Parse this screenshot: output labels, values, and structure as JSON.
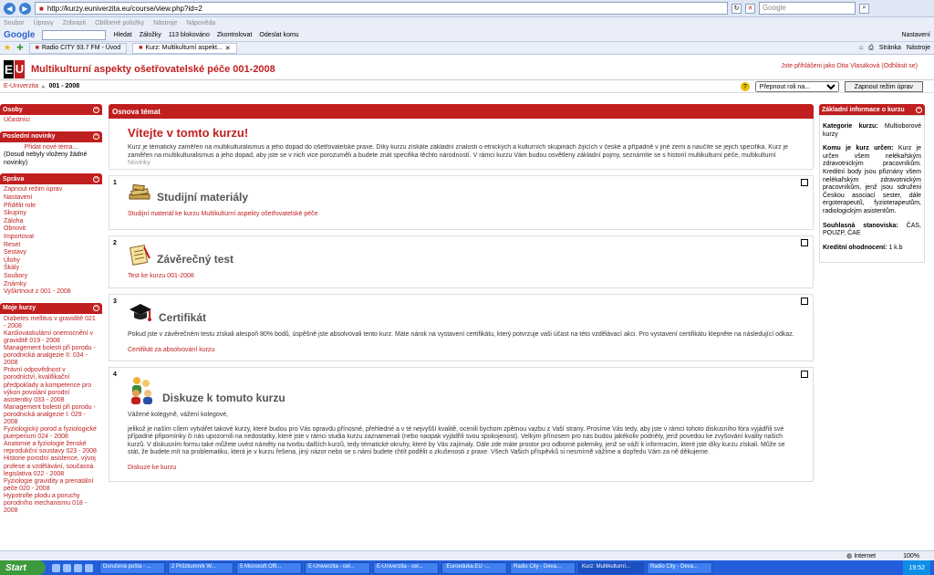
{
  "browser": {
    "url": "http://kurzy.euniverzita.eu/course/view.php?id=2",
    "search_placeholder": "Google",
    "menu": [
      "Soubor",
      "Úpravy",
      "Zobrazit",
      "Oblíbené položky",
      "Nástroje",
      "Nápověda"
    ],
    "google_toolbar": {
      "logo": "Google",
      "search": "Hledat",
      "bookmarks": "Záložky",
      "blocked": "113 blokováno",
      "check": "Zkontrolovat",
      "send": "Odeslat komu",
      "settings": "Nastavení"
    },
    "tabs": [
      {
        "label": "Radio CITY 93.7 FM - Úvod"
      },
      {
        "label": "Kurz: Multikulturní aspekt..."
      }
    ],
    "tools": {
      "page": "Stránka",
      "tools": "Nástroje"
    }
  },
  "site": {
    "logo_e": "E",
    "logo_u": "U",
    "course_title": "Multikulturní aspekty ošetřovatelské péče 001-2008",
    "login_info": "Jste přihlášeni jako Dita Vlasáková (Odhlásit se)",
    "breadcrumb_home": "E-Univerzita",
    "breadcrumb_sep": "▸",
    "breadcrumb_current": "001 - 2008",
    "role_select": "Přepnout roli na...",
    "edit_button": "Zapnout režim úprav",
    "help": "?"
  },
  "left": {
    "osoby": {
      "title": "Osoby",
      "items": [
        "Účastníci"
      ]
    },
    "news": {
      "title": "Poslední novinky",
      "add": "Přidat nové téma...",
      "none": "(Dosud nebyly vloženy žádné novinky)"
    },
    "admin": {
      "title": "Správa",
      "items": [
        "Zapnout režim úprav",
        "Nastavení",
        "Přidělit role",
        "Skupiny",
        "Záloha",
        "Obnovit",
        "Importovat",
        "Reset",
        "Sestavy",
        "Úlohy",
        "Škály",
        "Soubory",
        "Známky",
        "Vyškrtnout z 001 - 2008"
      ]
    },
    "mycourses": {
      "title": "Moje kurzy",
      "items": [
        "Diabetes mellitus v graviditě 021 - 2008",
        "Kardiovaskulární onemocnění v graviditě 019 - 2008",
        "Management bolesti při porodu - porodnická analgezie II: 034 - 2008",
        "Právní odpovědnost v porodnictví, kvalifikační předpoklady a kompetence pro výkon povolání porodní asistentky 033 - 2008",
        "Management bolesti při porodu - porodnická analgezie I: 029 - 2008",
        "Fyziologický porod a fyziologické puerperium 024 - 2008",
        "Anatomie a fyziologie ženské reprodukční soustavy 023 - 2008",
        "Historie porodní asistence, vývoj profese a vzdělávání, současná legislativa 022 - 2008",
        "Fyziologie gravidity a prenatální péče 020 - 2008",
        "Hypotrofie plodu a poruchy porodního mechanismu 018 - 2008"
      ]
    }
  },
  "center": {
    "header": "Osnova témat",
    "welcome_title": "Vítejte v tomto kurzu!",
    "welcome_text": "Kurz je tématicky zaměřen na multikulturalismus a jeho dopad do ošetřovatelské praxe. Díky kurzu získáte základní znalosti o etnických a kulturních skupinách žijících v české a případně v jiné zemi a naučíte se jejich specifika. Kurz je zaměřen na multikulturalismus a jeho dopad, aby jste se v nich vice porozuměli a budete znát specifika těchto národností. V rámci kurzu Vám budou osvětleny základní pojmy, seznámíte se s historií multikulturní péče, multikulturní výchovou i s etickými zásadami.",
    "welcome_news": "Novinky",
    "sections": [
      {
        "num": "1",
        "title": "Studijní materiály",
        "text": "",
        "link": "Studijní materiál ke kurzu Multikulturní aspekty ošetřovatelské péče",
        "icon": "books-icon"
      },
      {
        "num": "2",
        "title": "Závěrečný test",
        "text": "",
        "link": "Test ke kurzu 001-2008",
        "icon": "notepad-icon"
      },
      {
        "num": "3",
        "title": "Certifikát",
        "text": "Pokud jste v závěrečném testu získali alespoň 80% bodů, úspěšně jste absolvovali tento kurz. Máte nárok na vystavení certifikátu, který potvrzuje vaši účast na této vzdělávací akci. Pro vystavení certifikátu klepněte na následující odkaz.",
        "link": "Certifikát za absolvování kurzu",
        "icon": "graduation-cap-icon"
      },
      {
        "num": "4",
        "title": "Diskuze k tomuto kurzu",
        "greeting": "Vážené kolegyně, vážení kolegové,",
        "text": "jelikož je naším cílem vytvářet takové kurzy, které budou pro Vás opravdu přínosné, přehledné a v té nejvyšší kvalitě, ocenili bychom zpětnou vazbu z Vaší strany. Prosíme Vás tedy, aby jste v rámci tohoto diskusního fóra vyjádřili své případné připomínky či nás upozornili na nedostatky, které jste v rámci studia kurzu zaznamenali (nebo naopak vyjádřili svou spokojenost). Velkým přínosem pro nás budou jakékoliv podněty, jenž povedou ke zvyšování kvality našich kurzů. V diskusním formu také můžete uvést náměty na tvorbu dalších kurzů, tedy tématické okruhy, které by Vás zajímaly. Dále zde máte prostor pro odborné polemiky, jenž se váží k informacím, které jste díky kurzu získali. Může se stát, že budete mít na problematiku, která je v kurzu řešena, jiný názor nebo se s námi budete chtít podělit o zkušenosti z praxe. Všech Vašich příspěvků si nesmírně vážíme a dopředu Vám za ně děkujeme.",
        "link": "Diskuze ke kurzu",
        "icon": "people-icon"
      }
    ]
  },
  "right": {
    "title": "Základní informace o kurzu",
    "category_label": "Kategorie kurzu:",
    "category_value": "Multioborové kurzy",
    "for_label": "Komu je kurz určen:",
    "for_value": "Kurz je určen všem nelékařským zdravotnickým pracovníkům. Kreditní body jsou přiznány všem nelékařským zdravotnickým pracovníkům, jenž jsou sdruženi Českou asociací sester, dále ergoterapeutů, fyzioterapeutům, radiologickým asistentům.",
    "agreement_label": "Souhlasná stanoviska:",
    "agreement_value": "ČAS, POUZP, ČAE",
    "credits_label": "Kreditní ohodnocení:",
    "credits_value": "1 k.b"
  },
  "status": {
    "zone": "Internet",
    "zoom": "100%"
  },
  "taskbar": {
    "start": "Start",
    "tasks": [
      "Doručená pošta - ...",
      "2 Průzkumník W...",
      "5 Microsoft Offi...",
      "E-Univerzita - cel...",
      "E-Univerzita - cel...",
      ":Euroeduka.EU -...",
      "Radio City - Deva...",
      "Kurz: Multikulturní...",
      "Radio City - Deva..."
    ],
    "clock": "19:52"
  }
}
